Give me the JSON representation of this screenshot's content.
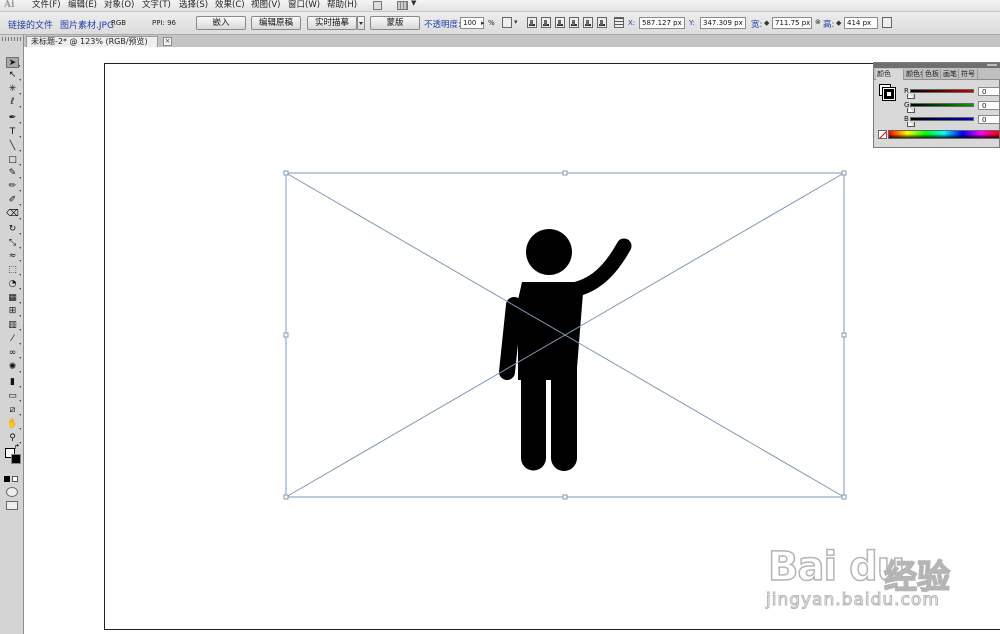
{
  "app": {
    "logo": "Ai"
  },
  "menu": {
    "items": [
      "文件(F)",
      "编辑(E)",
      "对象(O)",
      "文字(T)",
      "选择(S)",
      "效果(C)",
      "视图(V)",
      "窗口(W)",
      "帮助(H)"
    ]
  },
  "control_bar": {
    "linked_file_label": "链接的文件",
    "file_name": "图片素材.JPG",
    "color_mode": "RGB",
    "ppi_label": "PPI: 96",
    "embed_button": "嵌入",
    "edit_original_button": "编辑原稿",
    "live_trace_button": "实时描摹",
    "mask_button": "蒙版",
    "opacity_label": "不透明度:",
    "opacity_value": "100",
    "opacity_unit": "%",
    "x_label": "X:",
    "x_value": "587.127 px",
    "y_label": "Y:",
    "y_value": "347.309 px",
    "w_label": "宽:",
    "w_value": "711.75 px",
    "h_label": "高:",
    "h_value": "414 px"
  },
  "document": {
    "tab_title": "未标题-2* @ 123% (RGB/预览)",
    "close_glyph": "×"
  },
  "tools": [
    {
      "name": "selection-tool-icon",
      "glyph": "➤",
      "selected": true
    },
    {
      "name": "direct-selection-tool-icon",
      "glyph": "↖"
    },
    {
      "name": "magic-wand-tool-icon",
      "glyph": "✳"
    },
    {
      "name": "lasso-tool-icon",
      "glyph": "ℓ"
    },
    {
      "name": "pen-tool-icon",
      "glyph": "✒"
    },
    {
      "name": "type-tool-icon",
      "glyph": "T"
    },
    {
      "name": "line-tool-icon",
      "glyph": "╲"
    },
    {
      "name": "rectangle-tool-icon",
      "glyph": "□"
    },
    {
      "name": "paintbrush-tool-icon",
      "glyph": "✎"
    },
    {
      "name": "pencil-tool-icon",
      "glyph": "✏"
    },
    {
      "name": "blob-brush-tool-icon",
      "glyph": "✐"
    },
    {
      "name": "eraser-tool-icon",
      "glyph": "⌫"
    },
    {
      "name": "rotate-tool-icon",
      "glyph": "↻"
    },
    {
      "name": "scale-tool-icon",
      "glyph": "⤡"
    },
    {
      "name": "warp-tool-icon",
      "glyph": "≈"
    },
    {
      "name": "free-transform-tool-icon",
      "glyph": "⬚"
    },
    {
      "name": "shape-builder-tool-icon",
      "glyph": "◔"
    },
    {
      "name": "perspective-grid-tool-icon",
      "glyph": "▦"
    },
    {
      "name": "mesh-tool-icon",
      "glyph": "⊞"
    },
    {
      "name": "gradient-tool-icon",
      "glyph": "▥"
    },
    {
      "name": "eyedropper-tool-icon",
      "glyph": "⁄"
    },
    {
      "name": "blend-tool-icon",
      "glyph": "∞"
    },
    {
      "name": "symbol-sprayer-tool-icon",
      "glyph": "✺"
    },
    {
      "name": "column-graph-tool-icon",
      "glyph": "▮"
    },
    {
      "name": "artboard-tool-icon",
      "glyph": "▭"
    },
    {
      "name": "slice-tool-icon",
      "glyph": "⧄"
    },
    {
      "name": "hand-tool-icon",
      "glyph": "✋"
    },
    {
      "name": "zoom-tool-icon",
      "glyph": "⚲"
    }
  ],
  "color_panel": {
    "tabs": [
      "颜色",
      "颜色参考",
      "色板",
      "画笔",
      "符号"
    ],
    "channels": [
      {
        "label": "R",
        "value": "0",
        "color": "#cc0000"
      },
      {
        "label": "G",
        "value": "0",
        "color": "#00a000"
      },
      {
        "label": "B",
        "value": "0",
        "color": "#0000cc"
      }
    ]
  },
  "artwork": {
    "figure_color": "#000000",
    "bounding_box_color": "#7f98b5"
  },
  "watermark": {
    "brand": "Bai du",
    "cn": "经验",
    "url": "jingyan.baidu.com"
  }
}
